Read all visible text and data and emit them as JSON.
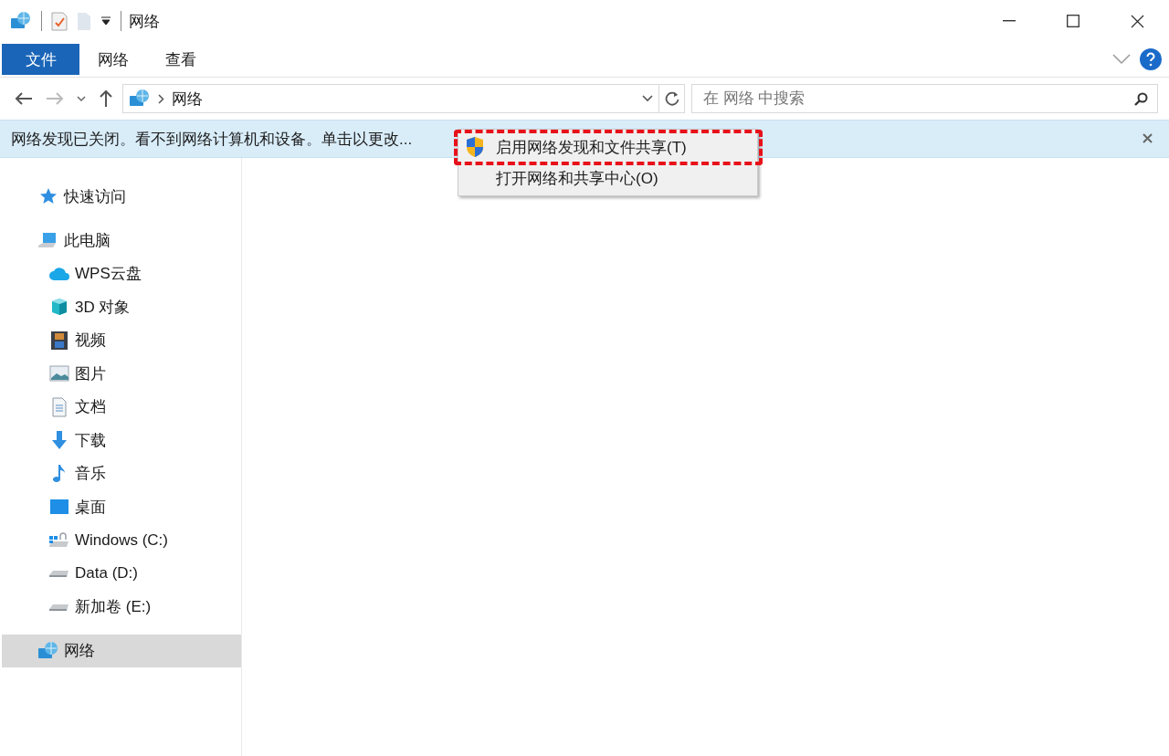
{
  "window": {
    "title": "网络"
  },
  "ribbon": {
    "tabs": [
      {
        "label": "文件",
        "kind": "file",
        "selected": false
      },
      {
        "label": "网络",
        "kind": "tab",
        "selected": false
      },
      {
        "label": "查看",
        "kind": "tab",
        "selected": false
      }
    ]
  },
  "address": {
    "path": [
      "网络"
    ]
  },
  "search": {
    "placeholder": "在 网络 中搜索"
  },
  "info_bar": {
    "message": "网络发现已关闭。看不到网络计算机和设备。单击以更改..."
  },
  "context_menu": {
    "items": [
      {
        "label": "启用网络发现和文件共享(T)",
        "kind": "shield",
        "annotated": true
      },
      {
        "label": "打开网络和共享中心(O)",
        "kind": "plain",
        "annotated": false
      }
    ]
  },
  "nav": {
    "items": [
      {
        "label": "快速访问",
        "kind": "star",
        "selected": false
      },
      {
        "label": "此电脑",
        "kind": "pc",
        "selected": false,
        "children": [
          {
            "label": "WPS云盘",
            "kind": "cloud",
            "selected": false
          },
          {
            "label": "3D 对象",
            "kind": "cube",
            "selected": false
          },
          {
            "label": "视频",
            "kind": "film",
            "selected": false
          },
          {
            "label": "图片",
            "kind": "picture",
            "selected": false
          },
          {
            "label": "文档",
            "kind": "document",
            "selected": false
          },
          {
            "label": "下载",
            "kind": "download",
            "selected": false
          },
          {
            "label": "音乐",
            "kind": "music",
            "selected": false
          },
          {
            "label": "桌面",
            "kind": "desktop",
            "selected": false
          },
          {
            "label": "Windows (C:)",
            "kind": "system-drive",
            "selected": false
          },
          {
            "label": "Data (D:)",
            "kind": "drive",
            "selected": false
          },
          {
            "label": "新加卷 (E:)",
            "kind": "drive",
            "selected": false
          }
        ]
      },
      {
        "label": "网络",
        "kind": "network",
        "selected": true
      }
    ]
  }
}
